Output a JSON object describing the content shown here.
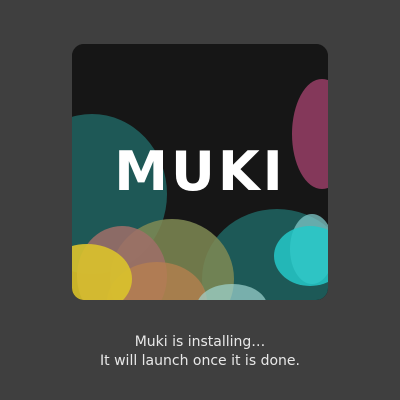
{
  "app": {
    "logo_text": "MUKI",
    "icon_name": "muki-app-icon"
  },
  "status": {
    "line1": "Muki is installing…",
    "line2": "It will launch once it is done."
  },
  "colors": {
    "background": "#3f3f3f",
    "icon_background": "#161616",
    "logo": "#ffffff",
    "text": "#e8e8e8"
  }
}
